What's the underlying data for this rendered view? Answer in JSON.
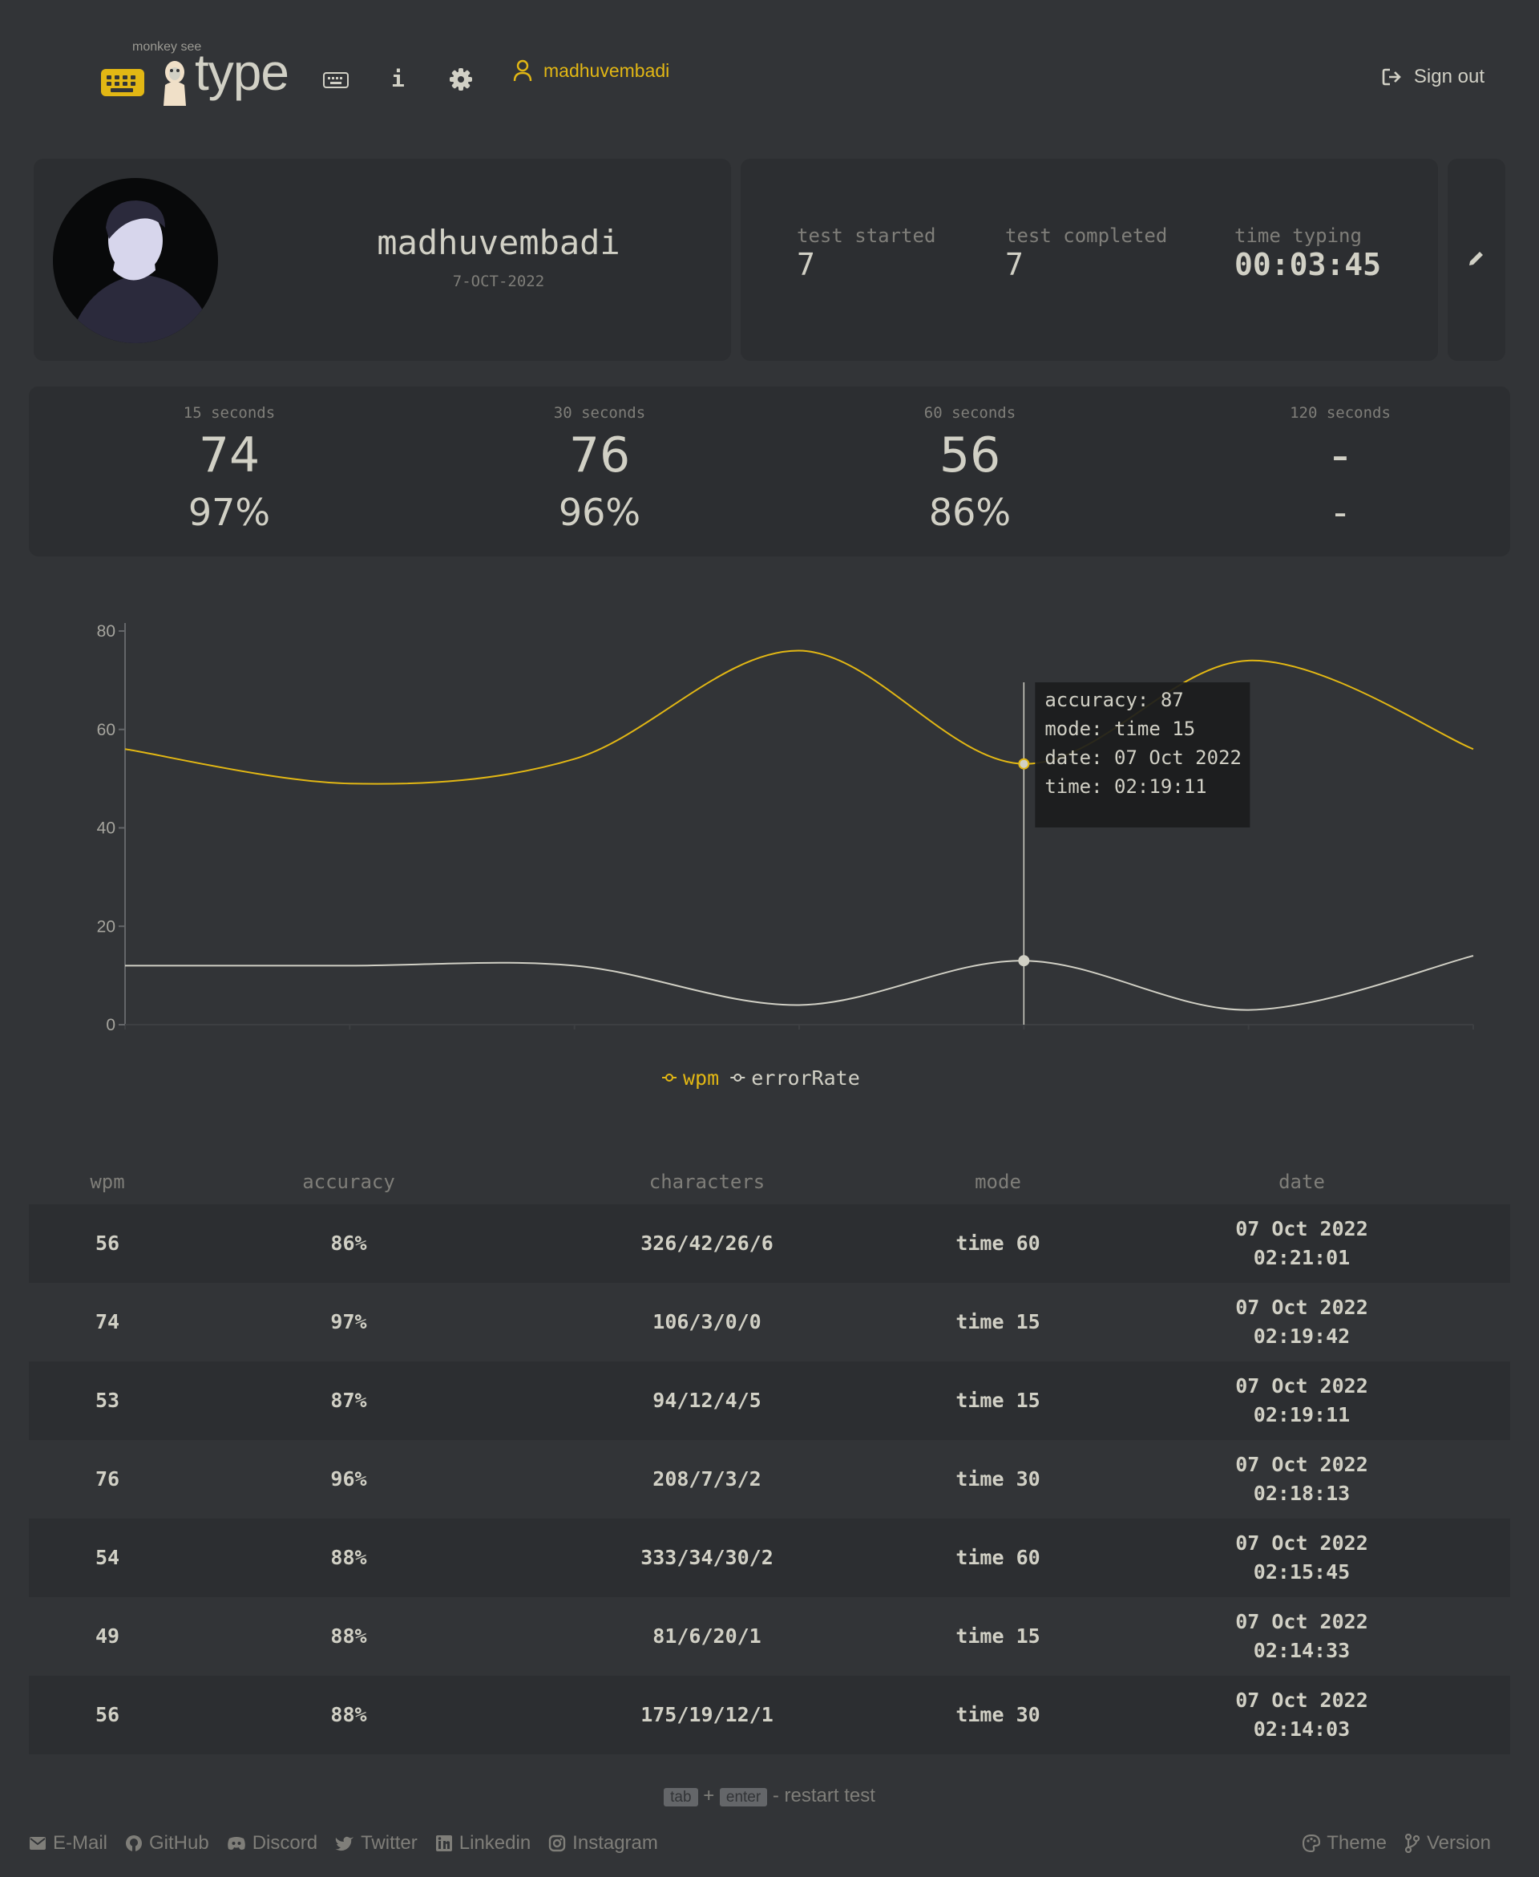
{
  "header": {
    "logo_top": "monkey see",
    "logo_word": "type",
    "username": "madhuvembadi",
    "signout_label": "Sign out"
  },
  "profile": {
    "name": "madhuvembadi",
    "joined": "7-OCT-2022"
  },
  "stats": [
    {
      "label": "test started",
      "value": "7"
    },
    {
      "label": "test completed",
      "value": "7"
    },
    {
      "label": "time typing",
      "value": "00:03:45"
    }
  ],
  "personal_bests": [
    {
      "label": "15 seconds",
      "wpm": "74",
      "acc": "97%"
    },
    {
      "label": "30 seconds",
      "wpm": "76",
      "acc": "96%"
    },
    {
      "label": "60 seconds",
      "wpm": "56",
      "acc": "86%"
    },
    {
      "label": "120 seconds",
      "wpm": "-",
      "acc": "-"
    }
  ],
  "chart_data": {
    "type": "line",
    "x": [
      1,
      2,
      3,
      4,
      5,
      6,
      7
    ],
    "series": [
      {
        "name": "wpm",
        "color": "#e2b714",
        "values": [
          56,
          49,
          54,
          76,
          53,
          74,
          56
        ]
      },
      {
        "name": "errorRate",
        "color": "#d1d0c5",
        "values": [
          12,
          12,
          12,
          4,
          13,
          3,
          14
        ]
      }
    ],
    "ylim": [
      0,
      80
    ],
    "yticks": [
      0,
      20,
      40,
      60,
      80
    ],
    "legend": "bottom-center",
    "tooltip": {
      "index": 4,
      "lines": [
        "accuracy: 87",
        "mode: time 15",
        "date: 07 Oct 2022",
        "time: 02:19:11"
      ]
    }
  },
  "table": {
    "headers": [
      "wpm",
      "accuracy",
      "characters",
      "mode",
      "date"
    ],
    "rows": [
      {
        "wpm": "56",
        "acc": "86%",
        "chars": "326/42/26/6",
        "mode": "time 60",
        "date": "07 Oct 2022",
        "time": "02:21:01"
      },
      {
        "wpm": "74",
        "acc": "97%",
        "chars": "106/3/0/0",
        "mode": "time 15",
        "date": "07 Oct 2022",
        "time": "02:19:42"
      },
      {
        "wpm": "53",
        "acc": "87%",
        "chars": "94/12/4/5",
        "mode": "time 15",
        "date": "07 Oct 2022",
        "time": "02:19:11"
      },
      {
        "wpm": "76",
        "acc": "96%",
        "chars": "208/7/3/2",
        "mode": "time 30",
        "date": "07 Oct 2022",
        "time": "02:18:13"
      },
      {
        "wpm": "54",
        "acc": "88%",
        "chars": "333/34/30/2",
        "mode": "time 60",
        "date": "07 Oct 2022",
        "time": "02:15:45"
      },
      {
        "wpm": "49",
        "acc": "88%",
        "chars": "81/6/20/1",
        "mode": "time 15",
        "date": "07 Oct 2022",
        "time": "02:14:33"
      },
      {
        "wpm": "56",
        "acc": "88%",
        "chars": "175/19/12/1",
        "mode": "time 30",
        "date": "07 Oct 2022",
        "time": "02:14:03"
      }
    ]
  },
  "footer": {
    "key_tab": "tab",
    "plus": "+",
    "key_enter": "enter",
    "hint": "- restart test",
    "links": [
      "E-Mail",
      "GitHub",
      "Discord",
      "Twitter",
      "Linkedin",
      "Instagram"
    ],
    "theme": "Theme",
    "version": "Version"
  },
  "colors": {
    "background": "#323437",
    "panel": "#2c2e31",
    "accent": "#e2b714",
    "text": "#d1d0c5",
    "sub": "#7f7e79"
  }
}
